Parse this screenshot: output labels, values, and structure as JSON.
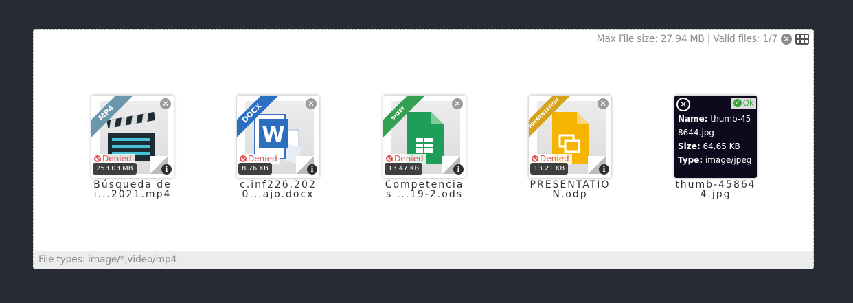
{
  "header": {
    "status": "Max File size: 27.94 MB | Valid files: 1/7",
    "clear_icon": "close-icon",
    "view_icon": "grid-icon"
  },
  "footer": {
    "file_types": "File types: image/*,video/mp4"
  },
  "files": [
    {
      "type_label": "MP4",
      "ribbon_color": "#6a97ab",
      "status": "Denied",
      "size": "253.03 MB",
      "name": "Búsqueda de i...2021.mp4",
      "icon": "clapperboard-icon"
    },
    {
      "type_label": "DOCX",
      "ribbon_color": "#2c6fc0",
      "status": "Denied",
      "size": "8.76 KB",
      "name": "c.inf226.2020...ajo.docx",
      "icon": "word-icon"
    },
    {
      "type_label": "SHEET",
      "ribbon_color": "#35a052",
      "status": "Denied",
      "size": "13.47 KB",
      "name": "Competencias ...19-2.ods",
      "icon": "spreadsheet-icon"
    },
    {
      "type_label": "PRESENTATION",
      "ribbon_color": "#d4a21c",
      "status": "Denied",
      "size": "13.21 KB",
      "name": "PRESENTATION.odp",
      "icon": "presentation-icon"
    },
    {
      "status": "Ok",
      "name_label": "Name:",
      "name_value": "thumb-458644.jpg",
      "size_label": "Size:",
      "size_value": "64.65 KB",
      "type_label": "Type:",
      "type_value": "image/jpeg",
      "name": "thumb-458644.jpg"
    }
  ]
}
